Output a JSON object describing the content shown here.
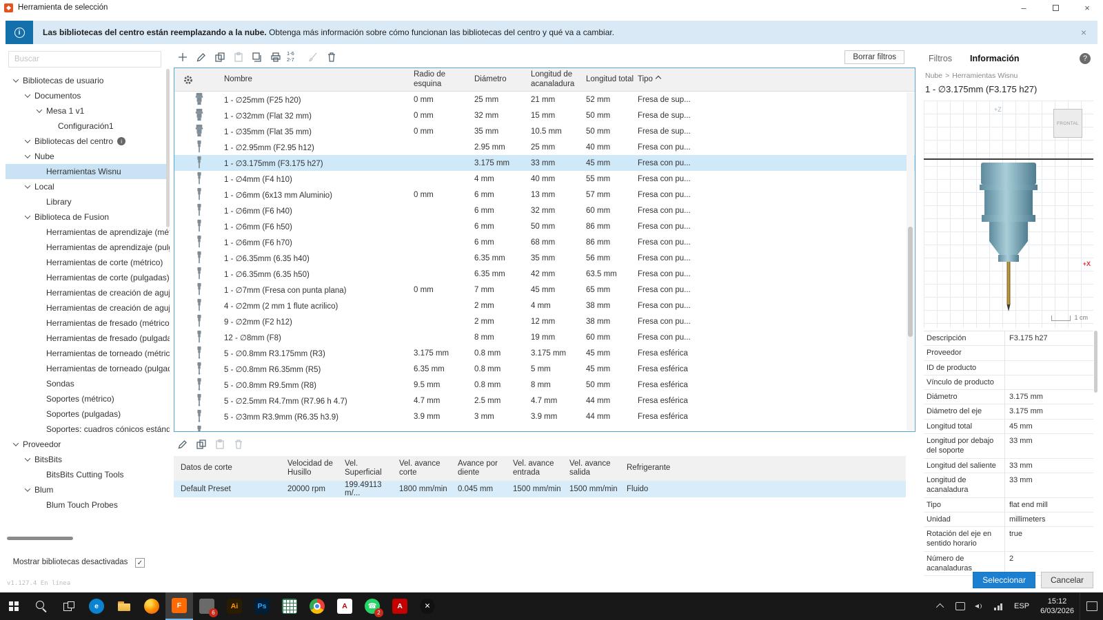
{
  "window": {
    "title": "Herramienta de selección",
    "minimize_glyph": "–",
    "close_glyph": "×",
    "status_version": "v1.127.4 En línea"
  },
  "banner": {
    "icon_glyph": "i",
    "bold_text": "Las bibliotecas del centro están reemplazando a la nube.",
    "text": " Obtenga más información sobre cómo funcionan las bibliotecas del centro y qué va a cambiar.",
    "close_glyph": "×"
  },
  "sidebar": {
    "search_placeholder": "Buscar",
    "show_disabled_label": "Mostrar bibliotecas desactivadas",
    "checkbox_glyph": "✓",
    "tree": [
      {
        "label": "Bibliotecas de usuario",
        "level": 0,
        "exp": true
      },
      {
        "label": "Documentos",
        "level": 1,
        "exp": true
      },
      {
        "label": "Mesa 1 v1",
        "level": 2,
        "exp": true
      },
      {
        "label": "Configuración1",
        "level": 3,
        "exp": false
      },
      {
        "label": "Bibliotecas del centro",
        "level": 1,
        "exp": true,
        "info": true
      },
      {
        "label": "Nube",
        "level": 1,
        "exp": true
      },
      {
        "label": "Herramientas Wisnu",
        "level": 2,
        "exp": false,
        "selected": true
      },
      {
        "label": "Local",
        "level": 1,
        "exp": true
      },
      {
        "label": "Library",
        "level": 2,
        "exp": false
      },
      {
        "label": "Biblioteca de Fusion",
        "level": 1,
        "exp": true
      },
      {
        "label": "Herramientas de aprendizaje (métri",
        "level": 2,
        "exp": false
      },
      {
        "label": "Herramientas de aprendizaje (pulga",
        "level": 2,
        "exp": false
      },
      {
        "label": "Herramientas de corte (métrico)",
        "level": 2,
        "exp": false
      },
      {
        "label": "Herramientas de corte (pulgadas)",
        "level": 2,
        "exp": false
      },
      {
        "label": "Herramientas de creación de agujer",
        "level": 2,
        "exp": false
      },
      {
        "label": "Herramientas de creación de agujer",
        "level": 2,
        "exp": false
      },
      {
        "label": "Herramientas de fresado (métrico)",
        "level": 2,
        "exp": false
      },
      {
        "label": "Herramientas de fresado (pulgadas",
        "level": 2,
        "exp": false
      },
      {
        "label": "Herramientas de torneado (métrico",
        "level": 2,
        "exp": false
      },
      {
        "label": "Herramientas de torneado (pulgada",
        "level": 2,
        "exp": false
      },
      {
        "label": "Sondas",
        "level": 2,
        "exp": false
      },
      {
        "label": "Soportes (métrico)",
        "level": 2,
        "exp": false
      },
      {
        "label": "Soportes (pulgadas)",
        "level": 2,
        "exp": false
      },
      {
        "label": "Soportes: cuadros cónicos estándar",
        "level": 2,
        "exp": false
      },
      {
        "label": "Proveedor",
        "level": 0,
        "exp": true
      },
      {
        "label": "BitsBits",
        "level": 1,
        "exp": true
      },
      {
        "label": "BitsBits Cutting Tools",
        "level": 2,
        "exp": false
      },
      {
        "label": "Blum",
        "level": 1,
        "exp": true
      },
      {
        "label": "Blum Touch Probes",
        "level": 2,
        "exp": false
      }
    ]
  },
  "main_toolbar": {
    "clear_filters": "Borrar filtros",
    "renumber_label": "1-6\n2-7"
  },
  "tool_table": {
    "columns": [
      "Nombre",
      "Radio de\nesquina",
      "Diámetro",
      "Longitud de\nacanaladura",
      "Longitud total",
      "Tipo"
    ],
    "sorted_column_index": 5,
    "rows": [
      {
        "icon": "face",
        "cells": [
          "1 - ∅25mm (F25 h20)",
          "0 mm",
          "25 mm",
          "21 mm",
          "52 mm",
          "Fresa de sup..."
        ],
        "selected": false
      },
      {
        "icon": "face",
        "cells": [
          "1 - ∅32mm (Flat 32 mm)",
          "0 mm",
          "32 mm",
          "15 mm",
          "50 mm",
          "Fresa de sup..."
        ],
        "selected": false
      },
      {
        "icon": "face",
        "cells": [
          "1 - ∅35mm (Flat 35 mm)",
          "0 mm",
          "35 mm",
          "10.5 mm",
          "50 mm",
          "Fresa de sup..."
        ],
        "selected": false
      },
      {
        "icon": "flat",
        "cells": [
          "1 - ∅2.95mm (F2.95 h12)",
          "",
          "2.95 mm",
          "25 mm",
          "40 mm",
          "Fresa con pu..."
        ],
        "selected": false
      },
      {
        "icon": "flat",
        "cells": [
          "1 - ∅3.175mm (F3.175 h27)",
          "",
          "3.175 mm",
          "33 mm",
          "45 mm",
          "Fresa con pu..."
        ],
        "selected": true
      },
      {
        "icon": "flat",
        "cells": [
          "1 - ∅4mm (F4 h10)",
          "",
          "4 mm",
          "40 mm",
          "55 mm",
          "Fresa con pu..."
        ],
        "selected": false
      },
      {
        "icon": "flat",
        "cells": [
          "1 - ∅6mm (6x13 mm Aluminio)",
          "0 mm",
          "6 mm",
          "13 mm",
          "57 mm",
          "Fresa con pu..."
        ],
        "selected": false
      },
      {
        "icon": "flat",
        "cells": [
          "1 - ∅6mm (F6 h40)",
          "",
          "6 mm",
          "32 mm",
          "60 mm",
          "Fresa con pu..."
        ],
        "selected": false
      },
      {
        "icon": "flat",
        "cells": [
          "1 - ∅6mm (F6 h50)",
          "",
          "6 mm",
          "50 mm",
          "86 mm",
          "Fresa con pu..."
        ],
        "selected": false
      },
      {
        "icon": "flat",
        "cells": [
          "1 - ∅6mm (F6 h70)",
          "",
          "6 mm",
          "68 mm",
          "86 mm",
          "Fresa con pu..."
        ],
        "selected": false
      },
      {
        "icon": "flat",
        "cells": [
          "1 - ∅6.35mm (6.35 h40)",
          "",
          "6.35 mm",
          "35 mm",
          "56 mm",
          "Fresa con pu..."
        ],
        "selected": false
      },
      {
        "icon": "flat",
        "cells": [
          "1 - ∅6.35mm (6.35 h50)",
          "",
          "6.35 mm",
          "42 mm",
          "63.5 mm",
          "Fresa con pu..."
        ],
        "selected": false
      },
      {
        "icon": "flat",
        "cells": [
          "1 - ∅7mm (Fresa con punta plana)",
          "0 mm",
          "7 mm",
          "45 mm",
          "65 mm",
          "Fresa con pu..."
        ],
        "selected": false
      },
      {
        "icon": "flat",
        "cells": [
          "4 - ∅2mm (2 mm 1 flute acrilico)",
          "",
          "2 mm",
          "4 mm",
          "38 mm",
          "Fresa con pu..."
        ],
        "selected": false
      },
      {
        "icon": "flat",
        "cells": [
          "9 - ∅2mm (F2 h12)",
          "",
          "2 mm",
          "12 mm",
          "38 mm",
          "Fresa con pu..."
        ],
        "selected": false
      },
      {
        "icon": "flat",
        "cells": [
          "12 - ∅8mm (F8)",
          "",
          "8 mm",
          "19 mm",
          "60 mm",
          "Fresa con pu..."
        ],
        "selected": false
      },
      {
        "icon": "ball",
        "cells": [
          "5 - ∅0.8mm R3.175mm (R3)",
          "3.175 mm",
          "0.8 mm",
          "3.175 mm",
          "45 mm",
          "Fresa esférica"
        ],
        "selected": false
      },
      {
        "icon": "ball",
        "cells": [
          "5 - ∅0.8mm R6.35mm (R5)",
          "6.35 mm",
          "0.8 mm",
          "5 mm",
          "45 mm",
          "Fresa esférica"
        ],
        "selected": false
      },
      {
        "icon": "ball",
        "cells": [
          "5 - ∅0.8mm R9.5mm (R8)",
          "9.5 mm",
          "0.8 mm",
          "8 mm",
          "50 mm",
          "Fresa esférica"
        ],
        "selected": false
      },
      {
        "icon": "ball",
        "cells": [
          "5 - ∅2.5mm R4.7mm (R7.96 h 4.7)",
          "4.7 mm",
          "2.5 mm",
          "4.7 mm",
          "44 mm",
          "Fresa esférica"
        ],
        "selected": false
      },
      {
        "icon": "ball",
        "cells": [
          "5 - ∅3mm R3.9mm (R6.35 h3.9)",
          "3.9 mm",
          "3 mm",
          "3.9 mm",
          "44 mm",
          "Fresa esférica"
        ],
        "selected": false
      },
      {
        "icon": "ball",
        "cells": [
          "",
          "",
          "",
          "",
          "",
          ""
        ],
        "selected": false
      }
    ]
  },
  "cutting_data": {
    "columns": [
      "Datos de corte",
      "Velocidad de\nHusillo",
      "Vel.\nSuperficial",
      "Vel. avance\ncorte",
      "Avance por\ndiente",
      "Vel. avance\nentrada",
      "Vel. avance\nsalida",
      "Refrigerante"
    ],
    "rows": [
      {
        "cells": [
          "Default Preset",
          "20000 rpm",
          "199.49113 m/...",
          "1800 mm/min",
          "0.045 mm",
          "1500 mm/min",
          "1500 mm/min",
          "Fluido"
        ],
        "selected": true
      }
    ]
  },
  "info_panel": {
    "tab_filters": "Filtros",
    "tab_information": "Información",
    "help_glyph": "?",
    "breadcrumb": {
      "parent": "Nube",
      "separator": ">",
      "current": "Herramientas Wisnu"
    },
    "tool_title": "1 - ∅3.175mm (F3.175 h27)",
    "viewcube_label": "FRONTAL",
    "axis_z_label": "+Z",
    "axis_x_label": "+X",
    "scale_label": "1 cm",
    "properties": [
      {
        "label": "Descripción",
        "value": "F3.175 h27"
      },
      {
        "label": "Proveedor",
        "value": ""
      },
      {
        "label": "ID de producto",
        "value": ""
      },
      {
        "label": "Vínculo de producto",
        "value": ""
      },
      {
        "label": "Diámetro",
        "value": "3.175 mm"
      },
      {
        "label": "Diámetro del eje",
        "value": "3.175 mm"
      },
      {
        "label": "Longitud total",
        "value": "45 mm"
      },
      {
        "label": "Longitud por debajo del soporte",
        "value": "33 mm"
      },
      {
        "label": "Longitud del saliente",
        "value": "33 mm"
      },
      {
        "label": "Longitud de acanaladura",
        "value": "33 mm"
      },
      {
        "label": "Tipo",
        "value": "flat end mill"
      },
      {
        "label": "Unidad",
        "value": "millimeters"
      },
      {
        "label": "Rotación del eje en sentido horario",
        "value": "true"
      },
      {
        "label": "Número de acanaladuras",
        "value": "2"
      }
    ],
    "select_button": "Seleccionar",
    "cancel_button": "Cancelar"
  },
  "taskbar": {
    "apps": [
      {
        "name": "start",
        "style": "win"
      },
      {
        "name": "search",
        "style": "search"
      },
      {
        "name": "task-view",
        "style": "taskview"
      },
      {
        "name": "edge",
        "bg": "#0a84d0",
        "glyph": "e",
        "round": true
      },
      {
        "name": "file-explorer",
        "style": "folder"
      },
      {
        "name": "firefox",
        "style": "firefox"
      },
      {
        "name": "fusion-360",
        "bg": "#ff6b00",
        "glyph": "F",
        "active": true
      },
      {
        "name": "cad-utility",
        "bg": "#6a6a6a",
        "glyph": "",
        "badge": "6"
      },
      {
        "name": "illustrator",
        "bg": "#2a1c00",
        "glyph": "Ai",
        "fg": "#ff9a00"
      },
      {
        "name": "photoshop",
        "bg": "#001e36",
        "glyph": "Ps",
        "fg": "#31a8ff"
      },
      {
        "name": "spreadsheet",
        "style": "grid"
      },
      {
        "name": "chrome",
        "style": "chrome"
      },
      {
        "name": "acrobat",
        "bg": "#ffffff",
        "glyph": "A",
        "fg": "#c00000"
      },
      {
        "name": "whatsapp",
        "bg": "#25d366",
        "glyph": "☎",
        "round": true,
        "badge": "2"
      },
      {
        "name": "autodesk-app",
        "bg": "#c40000",
        "glyph": "A"
      },
      {
        "name": "x-app",
        "bg": "#111111",
        "glyph": "✕",
        "round": true
      }
    ],
    "tray": {
      "lang": "ESP",
      "time": "15:12",
      "date": "6/03/2026"
    }
  }
}
